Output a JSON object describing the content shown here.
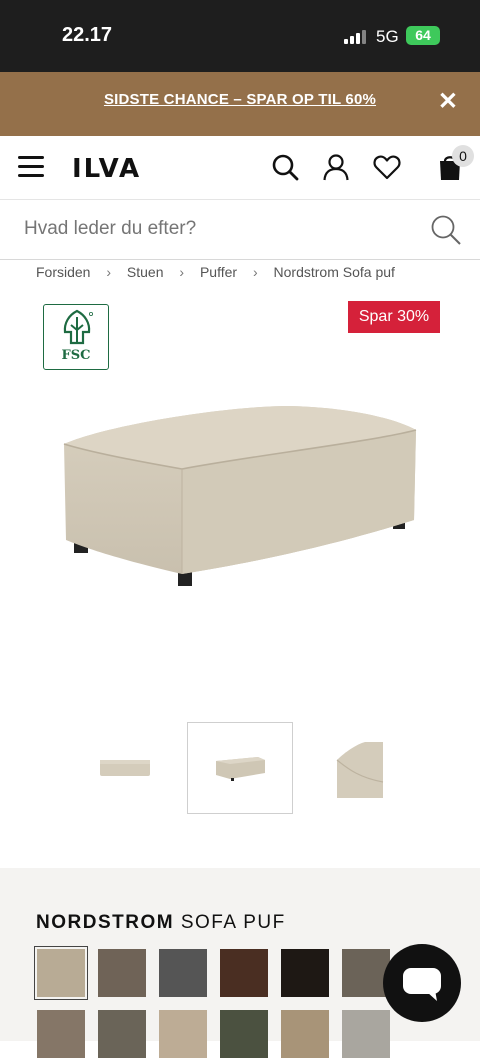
{
  "status_bar": {
    "time": "22.17",
    "network": "5G",
    "battery": "64"
  },
  "promo": {
    "text": "SIDSTE CHANCE – SPAR OP TIL 60%"
  },
  "header": {
    "logo": "ILVA",
    "icons": [
      "menu-icon",
      "search-icon",
      "account-icon",
      "heart-icon",
      "cart-icon"
    ],
    "cart_count": "0"
  },
  "search": {
    "placeholder": "Hvad leder du efter?"
  },
  "breadcrumb": {
    "items": [
      "Forsiden",
      "Stuen",
      "Puffer",
      "Nordstrom Sofa puf"
    ],
    "separator": "›"
  },
  "product": {
    "certification": "FSC",
    "discount_badge": "Spar 30%",
    "title_brand": "NORDSTROM",
    "title_rest": "SOFA PUF"
  },
  "thumbnails": {
    "count": 3,
    "active_index": 1
  },
  "swatches": {
    "colors": [
      "#b8ab95",
      "#6f6357",
      "#555555",
      "#4a2e22",
      "#1e1814",
      "#6b6358",
      "#857667",
      "#6a6458",
      "#bdac95",
      "#4b5140",
      "#a89478",
      "#a9a69f"
    ],
    "selected_index": 0
  },
  "colors": {
    "promo_bg": "#94704a",
    "sale_red": "#d5213a",
    "fsc_green": "#1e6b42",
    "fabric": "#d4ccbb"
  }
}
